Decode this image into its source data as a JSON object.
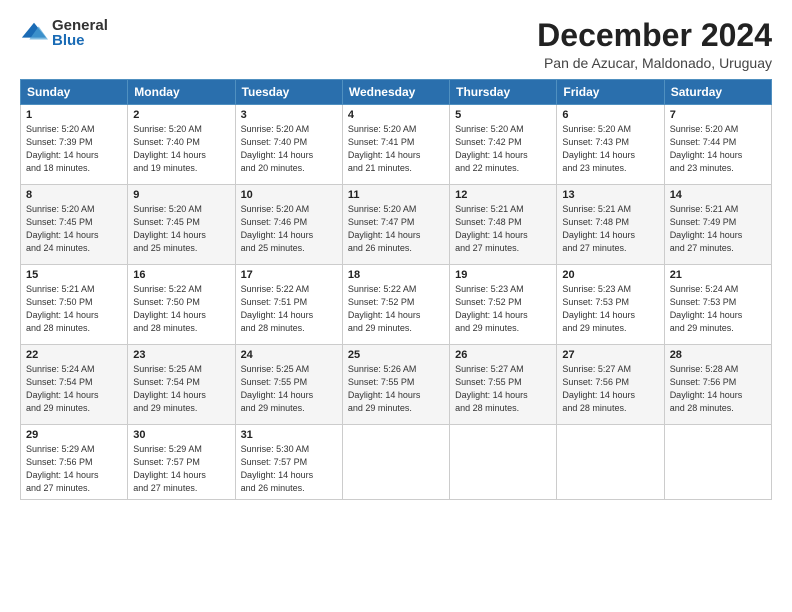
{
  "logo": {
    "general": "General",
    "blue": "Blue"
  },
  "title": "December 2024",
  "subtitle": "Pan de Azucar, Maldonado, Uruguay",
  "weekdays": [
    "Sunday",
    "Monday",
    "Tuesday",
    "Wednesday",
    "Thursday",
    "Friday",
    "Saturday"
  ],
  "weeks": [
    [
      {
        "day": "1",
        "info": "Sunrise: 5:20 AM\nSunset: 7:39 PM\nDaylight: 14 hours\nand 18 minutes."
      },
      {
        "day": "2",
        "info": "Sunrise: 5:20 AM\nSunset: 7:40 PM\nDaylight: 14 hours\nand 19 minutes."
      },
      {
        "day": "3",
        "info": "Sunrise: 5:20 AM\nSunset: 7:40 PM\nDaylight: 14 hours\nand 20 minutes."
      },
      {
        "day": "4",
        "info": "Sunrise: 5:20 AM\nSunset: 7:41 PM\nDaylight: 14 hours\nand 21 minutes."
      },
      {
        "day": "5",
        "info": "Sunrise: 5:20 AM\nSunset: 7:42 PM\nDaylight: 14 hours\nand 22 minutes."
      },
      {
        "day": "6",
        "info": "Sunrise: 5:20 AM\nSunset: 7:43 PM\nDaylight: 14 hours\nand 23 minutes."
      },
      {
        "day": "7",
        "info": "Sunrise: 5:20 AM\nSunset: 7:44 PM\nDaylight: 14 hours\nand 23 minutes."
      }
    ],
    [
      {
        "day": "8",
        "info": "Sunrise: 5:20 AM\nSunset: 7:45 PM\nDaylight: 14 hours\nand 24 minutes."
      },
      {
        "day": "9",
        "info": "Sunrise: 5:20 AM\nSunset: 7:45 PM\nDaylight: 14 hours\nand 25 minutes."
      },
      {
        "day": "10",
        "info": "Sunrise: 5:20 AM\nSunset: 7:46 PM\nDaylight: 14 hours\nand 25 minutes."
      },
      {
        "day": "11",
        "info": "Sunrise: 5:20 AM\nSunset: 7:47 PM\nDaylight: 14 hours\nand 26 minutes."
      },
      {
        "day": "12",
        "info": "Sunrise: 5:21 AM\nSunset: 7:48 PM\nDaylight: 14 hours\nand 27 minutes."
      },
      {
        "day": "13",
        "info": "Sunrise: 5:21 AM\nSunset: 7:48 PM\nDaylight: 14 hours\nand 27 minutes."
      },
      {
        "day": "14",
        "info": "Sunrise: 5:21 AM\nSunset: 7:49 PM\nDaylight: 14 hours\nand 27 minutes."
      }
    ],
    [
      {
        "day": "15",
        "info": "Sunrise: 5:21 AM\nSunset: 7:50 PM\nDaylight: 14 hours\nand 28 minutes."
      },
      {
        "day": "16",
        "info": "Sunrise: 5:22 AM\nSunset: 7:50 PM\nDaylight: 14 hours\nand 28 minutes."
      },
      {
        "day": "17",
        "info": "Sunrise: 5:22 AM\nSunset: 7:51 PM\nDaylight: 14 hours\nand 28 minutes."
      },
      {
        "day": "18",
        "info": "Sunrise: 5:22 AM\nSunset: 7:52 PM\nDaylight: 14 hours\nand 29 minutes."
      },
      {
        "day": "19",
        "info": "Sunrise: 5:23 AM\nSunset: 7:52 PM\nDaylight: 14 hours\nand 29 minutes."
      },
      {
        "day": "20",
        "info": "Sunrise: 5:23 AM\nSunset: 7:53 PM\nDaylight: 14 hours\nand 29 minutes."
      },
      {
        "day": "21",
        "info": "Sunrise: 5:24 AM\nSunset: 7:53 PM\nDaylight: 14 hours\nand 29 minutes."
      }
    ],
    [
      {
        "day": "22",
        "info": "Sunrise: 5:24 AM\nSunset: 7:54 PM\nDaylight: 14 hours\nand 29 minutes."
      },
      {
        "day": "23",
        "info": "Sunrise: 5:25 AM\nSunset: 7:54 PM\nDaylight: 14 hours\nand 29 minutes."
      },
      {
        "day": "24",
        "info": "Sunrise: 5:25 AM\nSunset: 7:55 PM\nDaylight: 14 hours\nand 29 minutes."
      },
      {
        "day": "25",
        "info": "Sunrise: 5:26 AM\nSunset: 7:55 PM\nDaylight: 14 hours\nand 29 minutes."
      },
      {
        "day": "26",
        "info": "Sunrise: 5:27 AM\nSunset: 7:55 PM\nDaylight: 14 hours\nand 28 minutes."
      },
      {
        "day": "27",
        "info": "Sunrise: 5:27 AM\nSunset: 7:56 PM\nDaylight: 14 hours\nand 28 minutes."
      },
      {
        "day": "28",
        "info": "Sunrise: 5:28 AM\nSunset: 7:56 PM\nDaylight: 14 hours\nand 28 minutes."
      }
    ],
    [
      {
        "day": "29",
        "info": "Sunrise: 5:29 AM\nSunset: 7:56 PM\nDaylight: 14 hours\nand 27 minutes."
      },
      {
        "day": "30",
        "info": "Sunrise: 5:29 AM\nSunset: 7:57 PM\nDaylight: 14 hours\nand 27 minutes."
      },
      {
        "day": "31",
        "info": "Sunrise: 5:30 AM\nSunset: 7:57 PM\nDaylight: 14 hours\nand 26 minutes."
      },
      null,
      null,
      null,
      null
    ]
  ]
}
